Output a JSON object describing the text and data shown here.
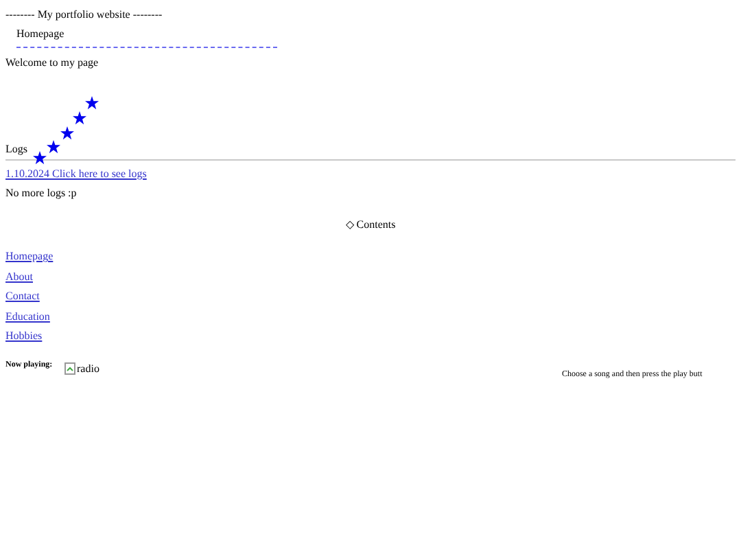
{
  "header": {
    "title": "-------- My portfolio website --------",
    "current_page": "Homepage"
  },
  "welcome": "Welcome to my page",
  "logs": {
    "heading": "Logs",
    "entries": [
      "1.10.2024 Click here to see logs"
    ],
    "footer": "No more logs :p"
  },
  "contents": {
    "symbol": "◇",
    "title": "Contents",
    "links": [
      "Homepage",
      "About",
      "Contact",
      "Education",
      "Hobbies"
    ]
  },
  "player": {
    "label": "Now playing:",
    "image_alt": "radio",
    "hint": "Choose a song and then press the play butt"
  }
}
